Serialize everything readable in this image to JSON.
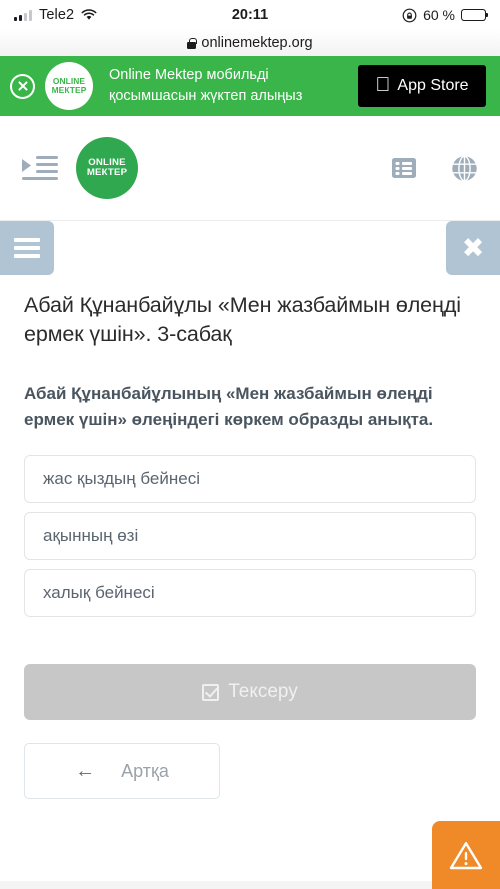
{
  "statusbar": {
    "carrier": "Tele2",
    "time": "20:11",
    "battery_percent": "60 %",
    "battery_level": 60,
    "signal_bars_filled": 2,
    "signal_bars_total": 4,
    "wifi_icon": "wifi-icon",
    "rotation_lock_icon": "rotation-lock-icon",
    "battery_icon": "battery-icon"
  },
  "urlbar": {
    "url": "onlinemektep.org",
    "lock_icon": "lock-icon"
  },
  "smart_banner": {
    "close_icon": "close-circle-icon",
    "logo_line1": "ONLINE",
    "logo_line2": "МЕКТЕP",
    "text_line1": "Online Mektep мобильді",
    "text_line2": "қосымшасын жүктеп алыңыз",
    "appstore_label": "App Store",
    "apple_glyph": "",
    "background_color": "#3ab54a"
  },
  "site_header": {
    "indent_menu_icon": "indent-menu-icon",
    "logo_line1": "ONLINE",
    "logo_line2": "МЕКТЕP",
    "list_icon": "list-icon",
    "globe_icon": "globe-icon",
    "logo_color": "#2fa84f"
  },
  "toolbar": {
    "menu_icon": "hamburger-menu-icon",
    "close_glyph": "✖",
    "button_color": "#b0c4d4"
  },
  "lesson": {
    "title": "Абай Құнанбайұлы «Мен жазбаймын өлеңді ермек үшін». 3-сабақ",
    "question": "Абай Құнанбайұлының «Мен жазбаймын өлеңді ермек үшін» өлеңіндегі көркем образды анықта.",
    "options": [
      {
        "label": "жас қыздың бейнесі"
      },
      {
        "label": "ақынның өзі"
      },
      {
        "label": "халық бейнесі"
      }
    ]
  },
  "actions": {
    "check_label": "Тексеру",
    "check_icon": "checkbox-checked-icon",
    "check_disabled": true,
    "check_color": "#c7c7c7",
    "back_label": "Артқа",
    "back_icon": "arrow-left-icon",
    "warning_icon": "warning-triangle-icon",
    "warning_color": "#f08a28"
  }
}
